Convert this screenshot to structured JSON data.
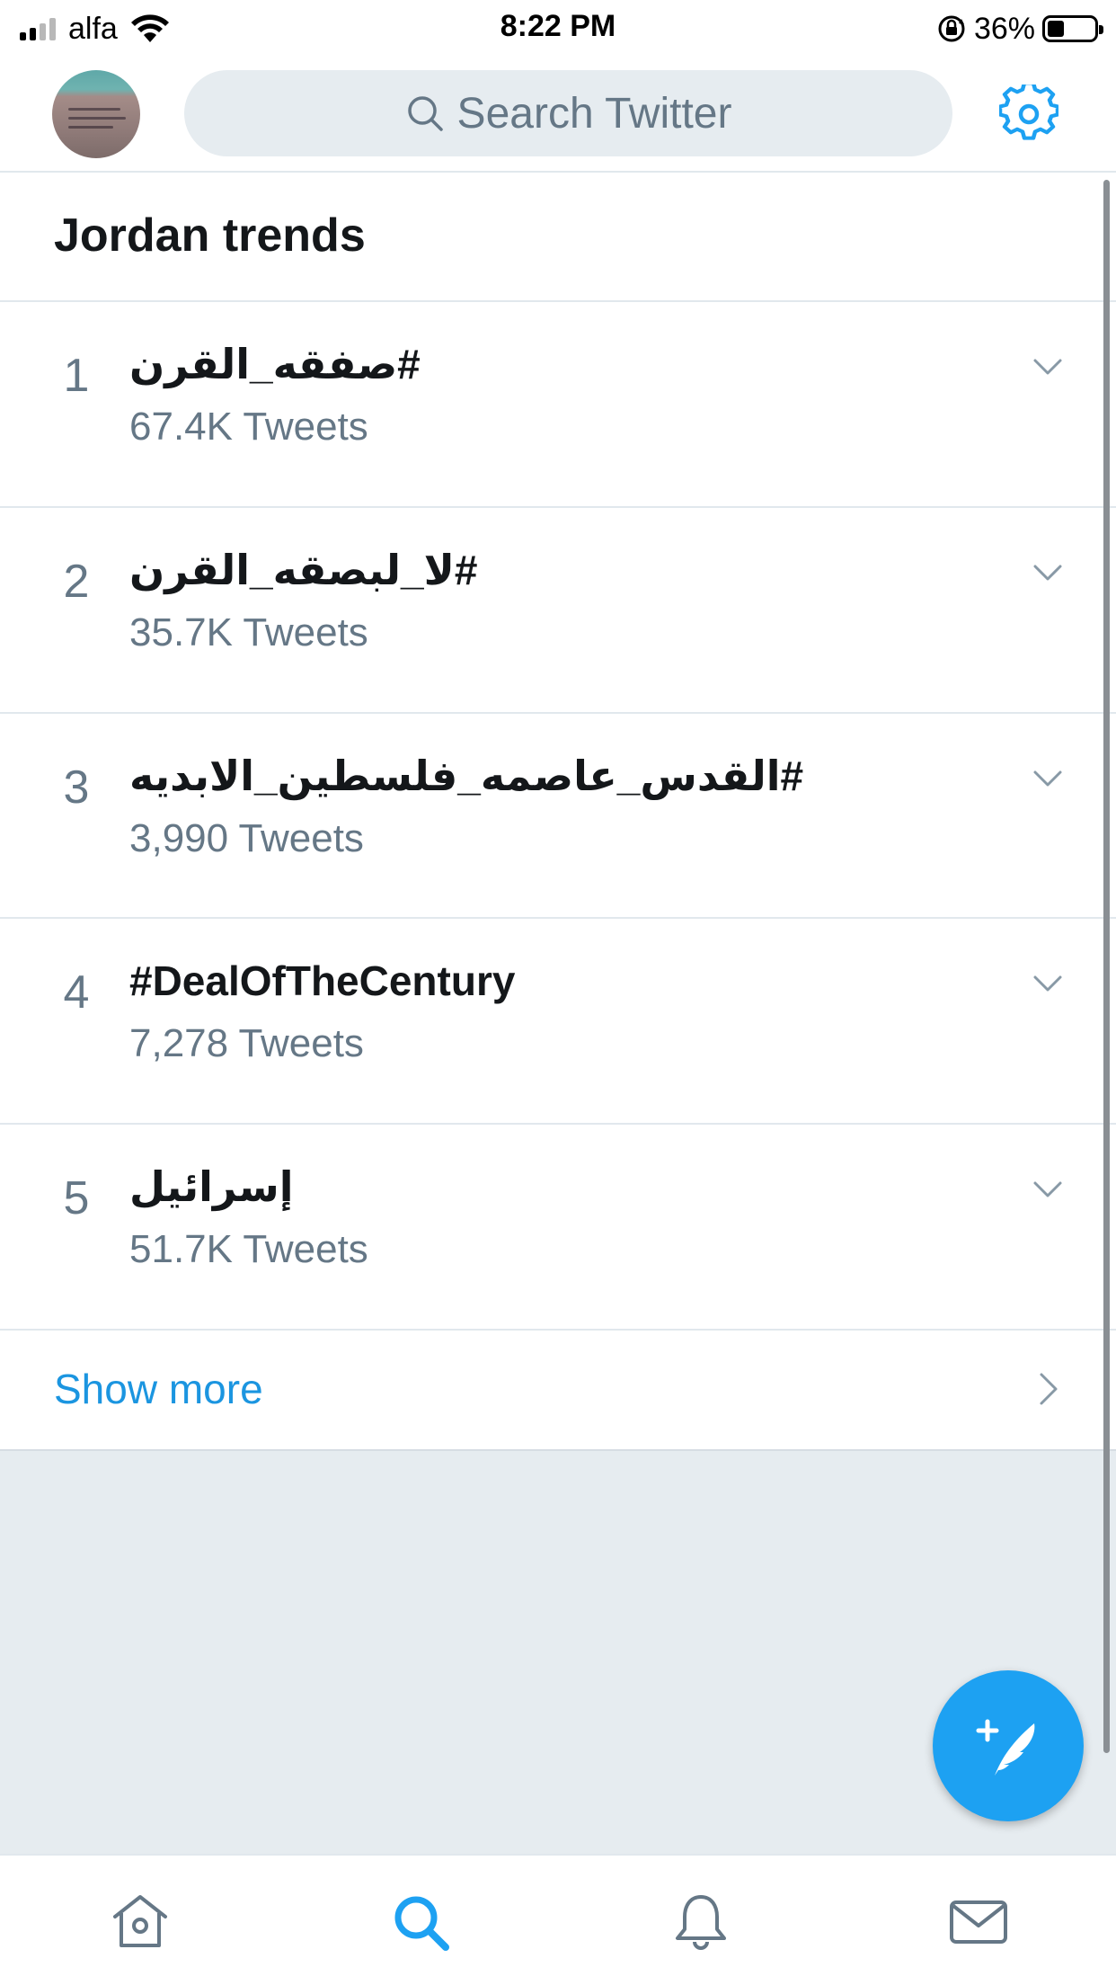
{
  "status_bar": {
    "carrier": "alfa",
    "time": "8:22 PM",
    "battery_percent": "36%",
    "signal_bars_filled": 2,
    "signal_bars_total": 4,
    "battery_level": 0.36
  },
  "header": {
    "avatar_icon": "profile-avatar",
    "search_placeholder": "Search Twitter",
    "settings_icon": "gear-icon"
  },
  "trends": {
    "title": "Jordan trends",
    "items": [
      {
        "rank": "1",
        "name": "#صفقه_القرن",
        "count": "67.4K Tweets"
      },
      {
        "rank": "2",
        "name": "#لا_لبصقه_القرن",
        "count": "35.7K Tweets"
      },
      {
        "rank": "3",
        "name": "#القدس_عاصمه_فلسطين_الابديه",
        "count": "3,990 Tweets"
      },
      {
        "rank": "4",
        "name": "#DealOfTheCentury",
        "count": "7,278 Tweets"
      },
      {
        "rank": "5",
        "name": "إسرائيل",
        "count": "51.7K Tweets"
      }
    ],
    "show_more": "Show more"
  },
  "fab": {
    "icon": "compose-tweet-icon"
  },
  "tab_bar": {
    "tabs": [
      {
        "icon": "home-icon",
        "active": false
      },
      {
        "icon": "search-icon",
        "active": true
      },
      {
        "icon": "bell-icon",
        "active": false
      },
      {
        "icon": "mail-icon",
        "active": false
      }
    ]
  },
  "colors": {
    "accent": "#1da1f2",
    "link": "#1b95e0",
    "secondary_text": "#657786",
    "primary_text": "#14171a",
    "background_gray": "#e6ecf0"
  }
}
